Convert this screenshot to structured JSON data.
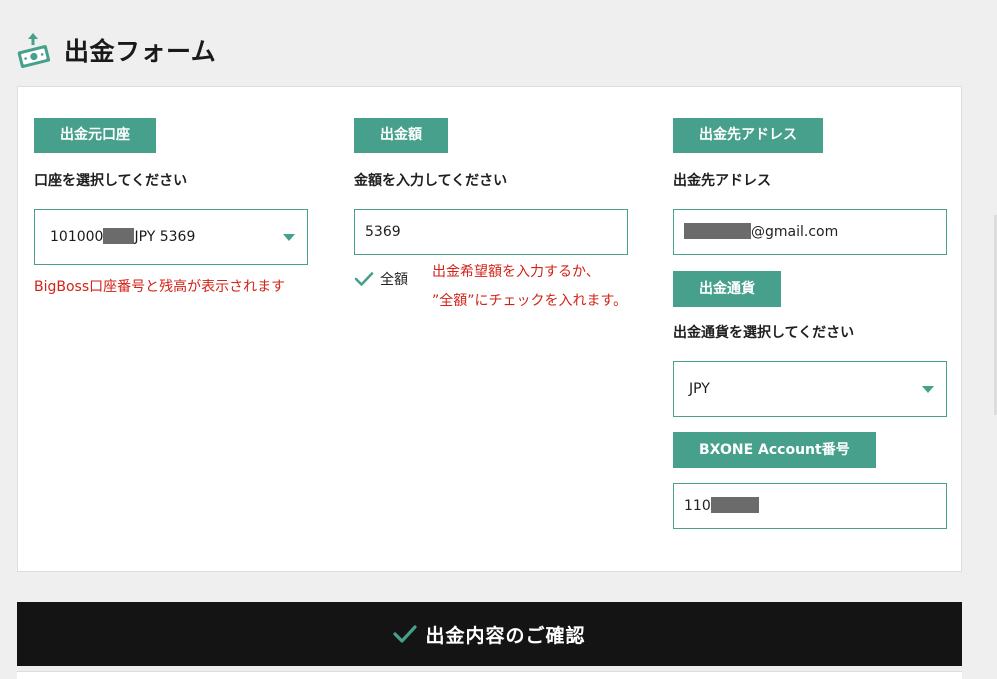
{
  "header": {
    "title": "出金フォーム",
    "icon": "money-withdraw-icon",
    "accent_color": "#46a08c"
  },
  "source_account": {
    "section_label": "出金元口座",
    "field_label": "口座を選択してください",
    "selected_prefix": "101000",
    "selected_suffix": "JPY 5369",
    "note": "BigBoss口座番号と残高が表示されます"
  },
  "amount": {
    "section_label": "出金額",
    "field_label": "金額を入力してください",
    "value": "5369",
    "full_amount_label": "全額",
    "full_amount_checked": true,
    "note_line1": "出金希望額を入力するか、",
    "note_line2": "”全額”にチェックを入れます。"
  },
  "destination": {
    "section_label": "出金先アドレス",
    "field_label": "出金先アドレス",
    "address_suffix": "@gmail.com",
    "currency_section_label": "出金通貨",
    "currency_field_label": "出金通貨を選択してください",
    "currency_value": "JPY",
    "account_section_label": "BXONE Account番号",
    "account_prefix": "110"
  },
  "confirm": {
    "label": "出金内容のご確認"
  }
}
